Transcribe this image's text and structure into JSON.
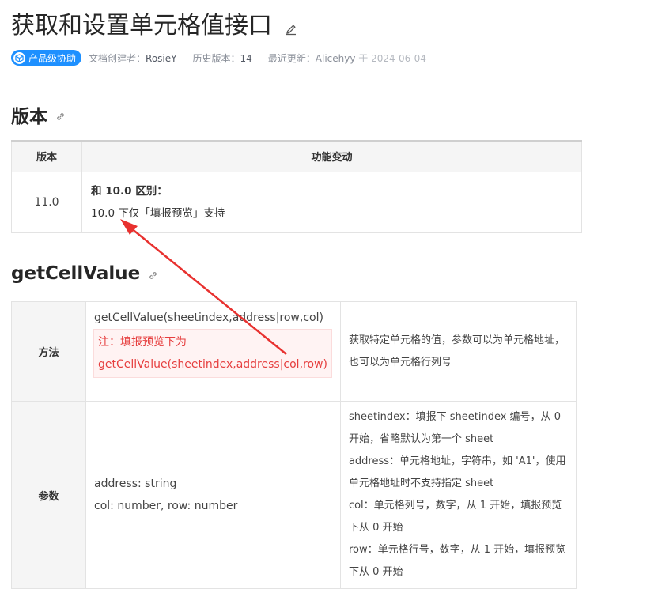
{
  "page": {
    "title": "获取和设置单元格值接口"
  },
  "meta": {
    "badge_label": "产品级协助",
    "creator_label": "文档创建者：",
    "creator": "RosieY",
    "history_label": "历史版本：",
    "history": "14",
    "updated_label": "最近更新：",
    "updated_by": "Alicehyy",
    "updated_on_label": "于",
    "updated_date": "2024-06-04"
  },
  "version_section": {
    "heading": "版本",
    "table": {
      "headers": [
        "版本",
        "功能变动"
      ],
      "rows": [
        {
          "version": "11.0",
          "change_title": "和 10.0 区别：",
          "change_text": "10.0 下仅「填报预览」支持"
        }
      ]
    }
  },
  "getcellvalue_section": {
    "heading": "getCellValue",
    "table": {
      "rows": [
        {
          "label": "方法",
          "signature": "getCellValue(sheetindex,address|row,col)",
          "note": "注：填报预览下为 getCellValue(sheetindex,address|col,row)",
          "description": "获取特定单元格的值，参数可以为单元格地址，也可以为单元格行列号"
        },
        {
          "label": "参数",
          "types": [
            "address: string",
            "col: number, row: number"
          ],
          "descriptions": [
            "sheetindex：填报下 sheetindex 编号，从 0 开始，省略默认为第一个 sheet",
            "address：单元格地址，字符串，如 'A1'，使用单元格地址时不支持指定 sheet",
            "col：单元格列号，数字，从 1 开始，填报预览下从 0 开始",
            "row：单元格行号，数字，从 1 开始，填报预览下从 0 开始"
          ]
        }
      ]
    }
  },
  "colors": {
    "accent": "#1e90ff",
    "annotation": "#e8312f",
    "note_text": "#e63e3e"
  },
  "icons": {
    "edit": "pencil-icon",
    "link": "link-icon",
    "badge": "cube-icon",
    "annotation": "red-arrow"
  }
}
